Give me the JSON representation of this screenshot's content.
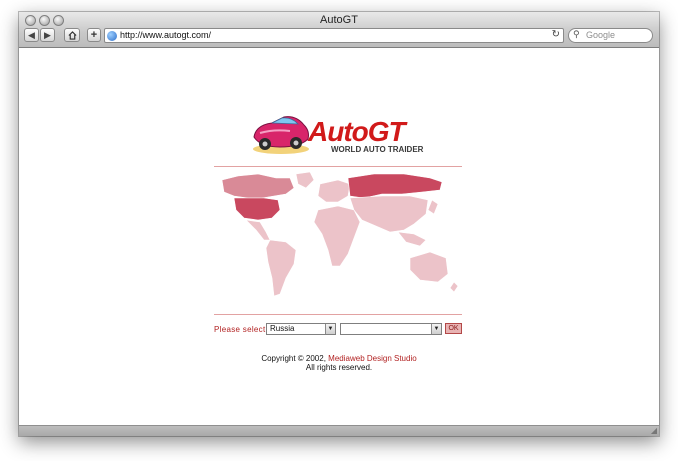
{
  "browser": {
    "title": "AutoGT",
    "url": "http://www.autogt.com/",
    "search_placeholder": "Google"
  },
  "page": {
    "logo_text": "AutoGT",
    "logo_subtitle": "WORLD AUTO TRAIDER",
    "select_label": "Please select",
    "country_value": "Russia",
    "second_value": "",
    "ok_label": "OK",
    "copyright_prefix": "Copyright © 2002,",
    "copyright_link": "Mediaweb Design Studio",
    "rights": "All rights reserved."
  },
  "colors": {
    "accent": "#d11a1a",
    "map_highlight": "#d98a97",
    "map_land": "#ecc3c9"
  },
  "icons": {
    "back": "chevron-left-icon",
    "forward": "chevron-right-icon",
    "home": "home-icon",
    "add": "plus-icon",
    "reload": "reload-icon",
    "search": "search-icon"
  }
}
